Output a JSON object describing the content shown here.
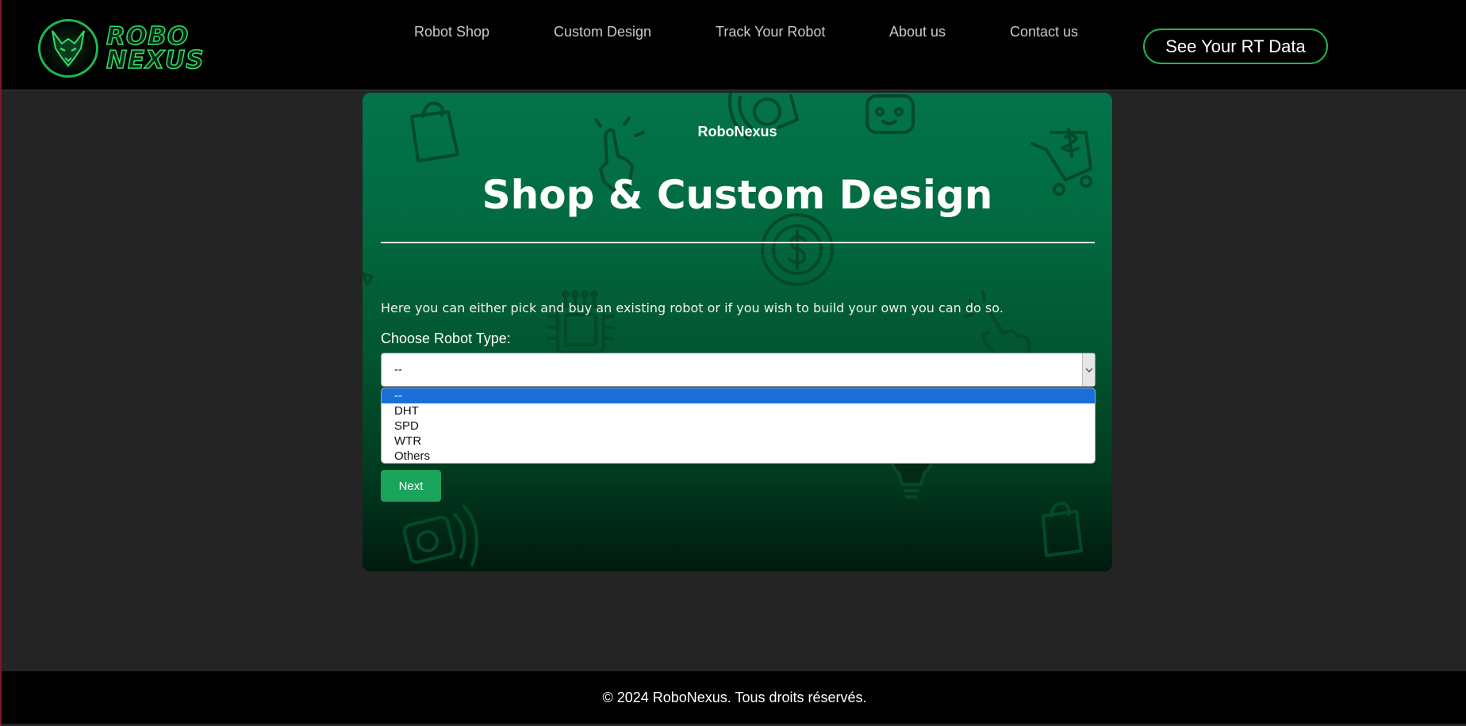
{
  "header": {
    "logo": {
      "line1": "ROBO",
      "line2": "NEXUS"
    },
    "nav": [
      {
        "label": "Robot Shop"
      },
      {
        "label": "Custom Design"
      },
      {
        "label": "Track Your Robot"
      },
      {
        "label": "About us"
      },
      {
        "label": "Contact us"
      }
    ],
    "cta_label": "See Your RT Data"
  },
  "card": {
    "brand": "RoboNexus",
    "title": "Shop & Custom Design",
    "intro": "Here you can either pick and buy an existing robot or if you wish to build your own you can do so.",
    "select_label": "Choose Robot Type:",
    "select_value": "--",
    "options": [
      "--",
      "DHT",
      "SPD",
      "WTR",
      "Others"
    ],
    "selected_option": "--",
    "next_label": "Next"
  },
  "footer": {
    "text": "© 2024 RoboNexus. Tous droits réservés."
  },
  "colors": {
    "accent": "#1db954",
    "card_top": "#03744a",
    "card_bottom": "#011a0e",
    "option_highlight": "#1a6fd8",
    "button": "#1aa35a"
  }
}
